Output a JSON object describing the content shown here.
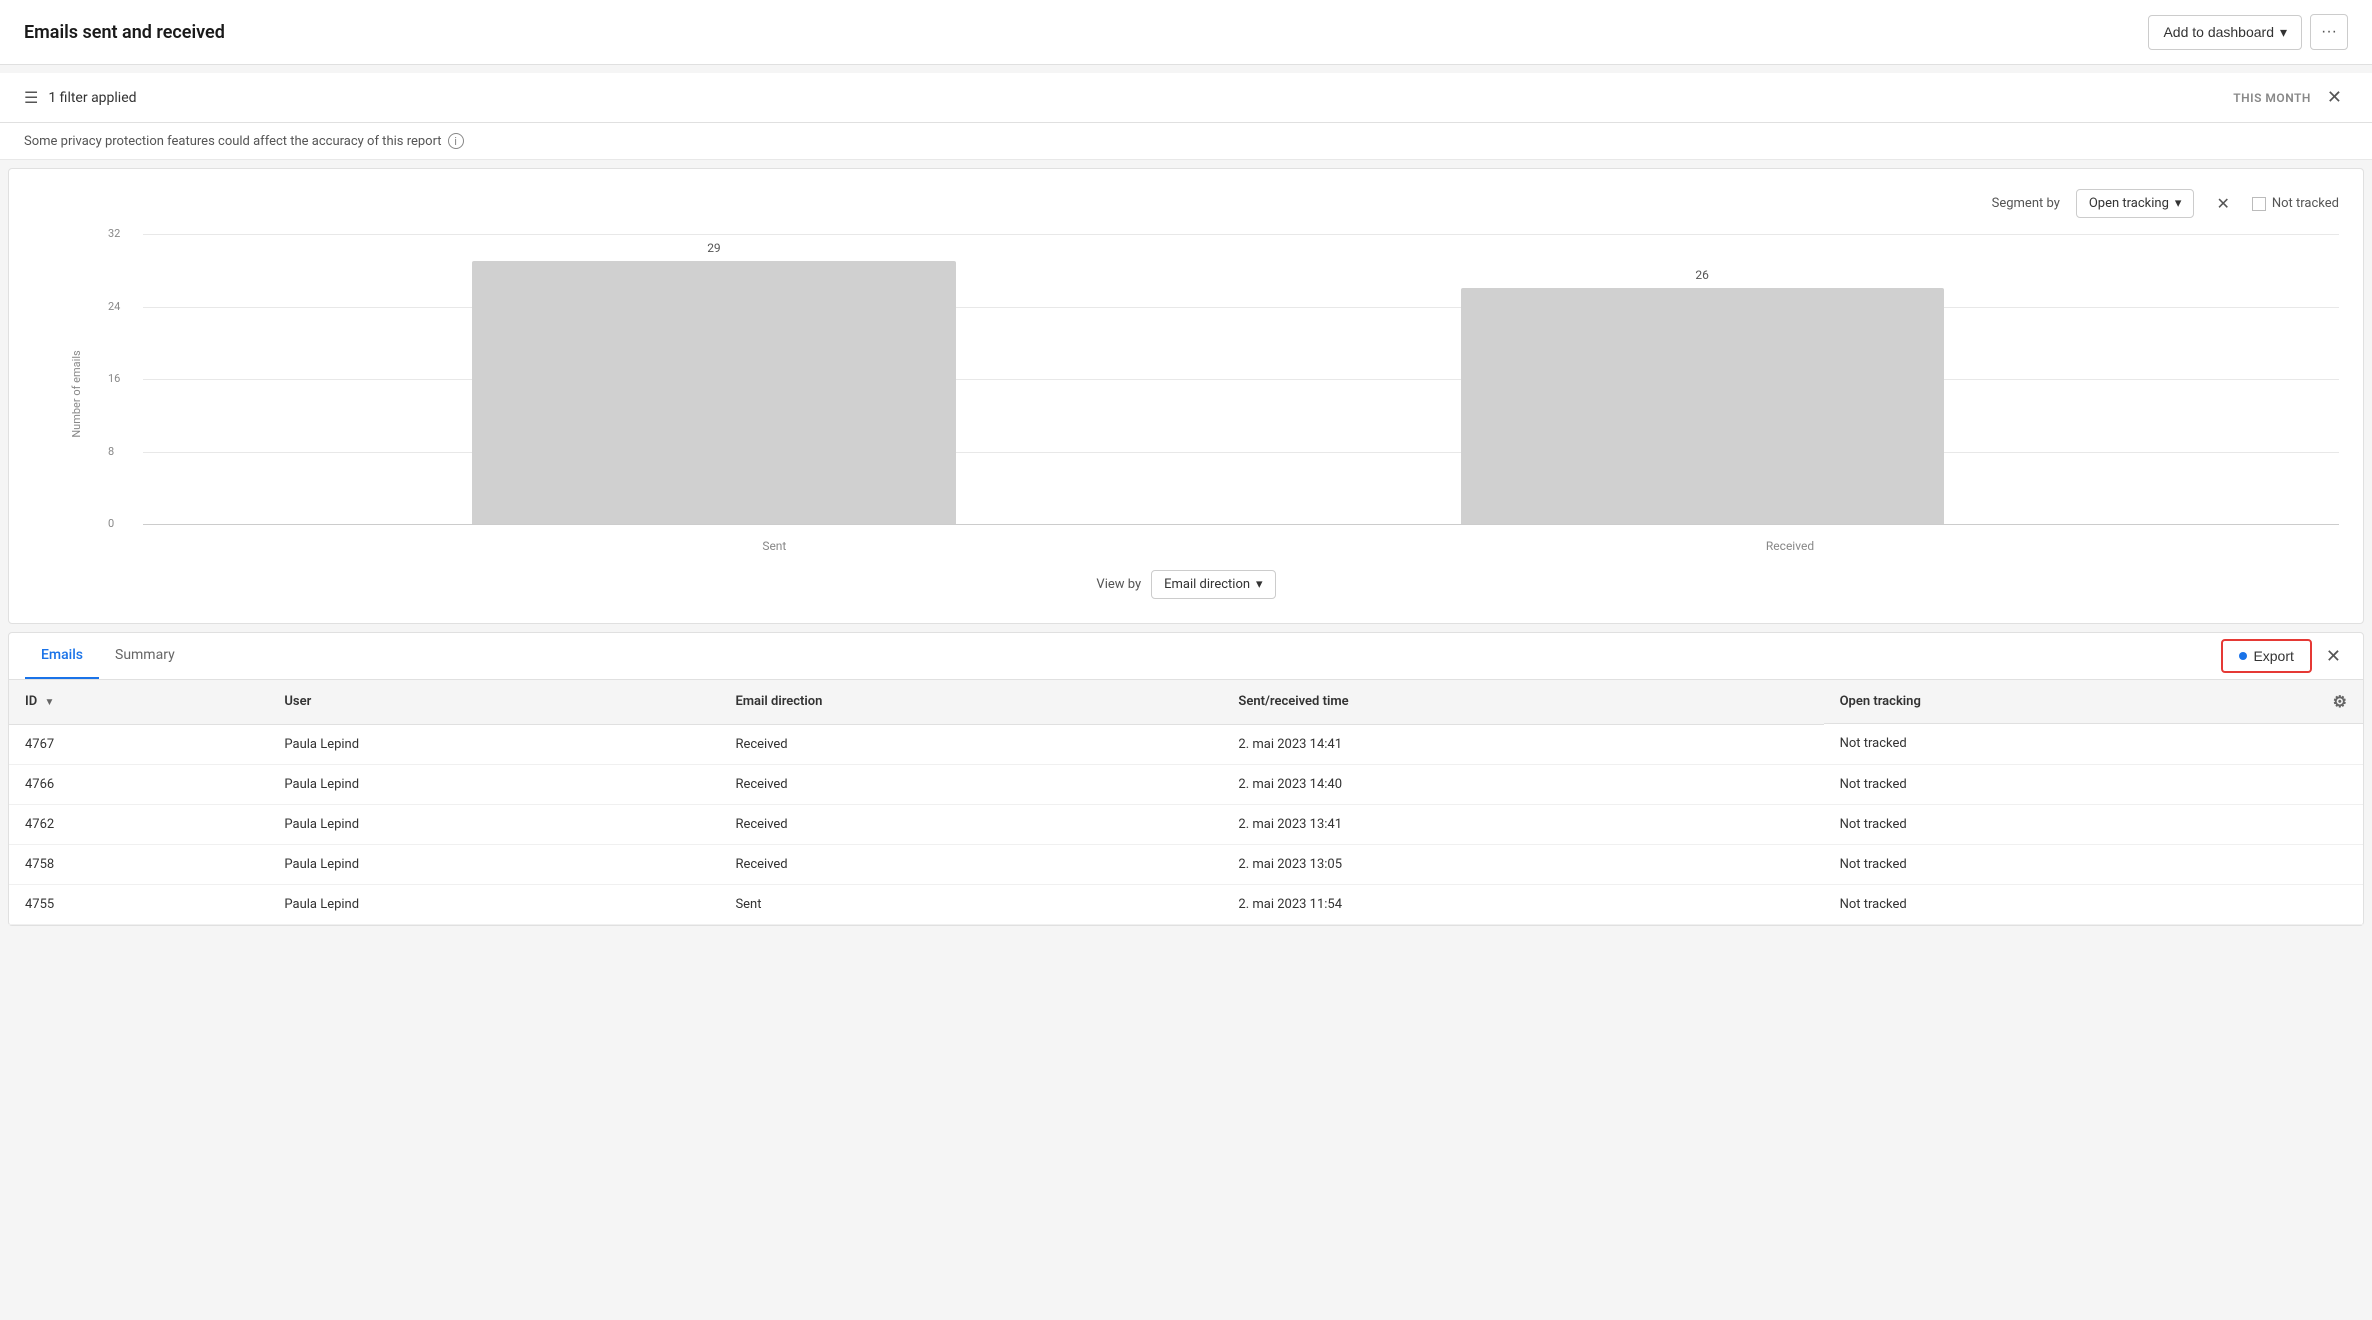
{
  "header": {
    "title": "Emails sent and received",
    "add_dashboard_label": "Add to dashboard",
    "more_icon": "⋯"
  },
  "filter_bar": {
    "filter_label": "1 filter applied",
    "time_range": "THIS MONTH"
  },
  "privacy_notice": {
    "text": "Some privacy protection features could affect the accuracy of this report"
  },
  "chart": {
    "segment_by_label": "Segment by",
    "segment_value": "Open tracking",
    "legend": {
      "label": "Not tracked"
    },
    "y_axis_label": "Number of emails",
    "y_ticks": [
      "32",
      "24",
      "16",
      "8",
      "0"
    ],
    "bars": [
      {
        "label": "Sent",
        "value": 29,
        "display": "29"
      },
      {
        "label": "Received",
        "value": 26,
        "display": "26"
      }
    ],
    "max_value": 32,
    "view_by_label": "View by",
    "view_by_value": "Email direction"
  },
  "table": {
    "tabs": [
      {
        "label": "Emails",
        "active": true
      },
      {
        "label": "Summary",
        "active": false
      }
    ],
    "export_label": "Export",
    "columns": [
      {
        "label": "ID",
        "sortable": true
      },
      {
        "label": "User",
        "sortable": false
      },
      {
        "label": "Email direction",
        "sortable": false
      },
      {
        "label": "Sent/received time",
        "sortable": false
      },
      {
        "label": "Open tracking",
        "sortable": false
      }
    ],
    "rows": [
      {
        "id": "4767",
        "user": "Paula Lepind",
        "direction": "Received",
        "time": "2. mai 2023 14:41",
        "tracking": "Not tracked"
      },
      {
        "id": "4766",
        "user": "Paula Lepind",
        "direction": "Received",
        "time": "2. mai 2023 14:40",
        "tracking": "Not tracked"
      },
      {
        "id": "4762",
        "user": "Paula Lepind",
        "direction": "Received",
        "time": "2. mai 2023 13:41",
        "tracking": "Not tracked"
      },
      {
        "id": "4758",
        "user": "Paula Lepind",
        "direction": "Received",
        "time": "2. mai 2023 13:05",
        "tracking": "Not tracked"
      },
      {
        "id": "4755",
        "user": "Paula Lepind",
        "direction": "Sent",
        "time": "2. mai 2023 11:54",
        "tracking": "Not tracked"
      }
    ]
  }
}
